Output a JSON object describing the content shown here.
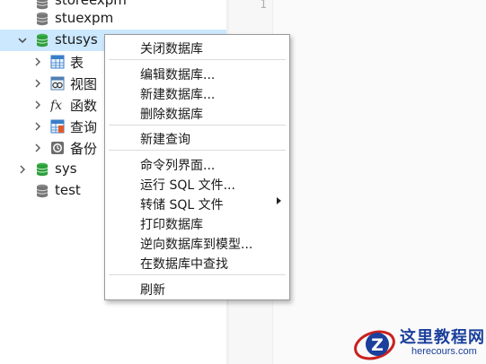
{
  "tree": {
    "items": [
      {
        "label": "storeexpm",
        "icon": "database-icon"
      },
      {
        "label": "stuexpm",
        "icon": "database-icon"
      },
      {
        "label": "stusys",
        "icon": "database-open-icon",
        "expanded": true,
        "selected": true
      },
      {
        "label": "表",
        "icon": "table-icon"
      },
      {
        "label": "视图",
        "icon": "view-icon"
      },
      {
        "label": "函数",
        "icon": "function-icon"
      },
      {
        "label": "查询",
        "icon": "query-icon"
      },
      {
        "label": "备份",
        "icon": "backup-icon"
      },
      {
        "label": "sys",
        "icon": "database-open-icon"
      },
      {
        "label": "test",
        "icon": "database-icon"
      }
    ]
  },
  "editor": {
    "line_number": "1"
  },
  "context_menu": {
    "items": [
      {
        "label": "关闭数据库"
      },
      {
        "label": "编辑数据库..."
      },
      {
        "label": "新建数据库..."
      },
      {
        "label": "删除数据库"
      },
      {
        "label": "新建查询"
      },
      {
        "label": "命令列界面..."
      },
      {
        "label": "运行 SQL 文件..."
      },
      {
        "label": "转储 SQL 文件",
        "has_submenu": true
      },
      {
        "label": "打印数据库"
      },
      {
        "label": "逆向数据库到模型..."
      },
      {
        "label": "在数据库中查找"
      },
      {
        "label": "刷新"
      }
    ]
  },
  "watermark": {
    "title": "这里教程网",
    "url": "herecours.com",
    "logo_letter": "Z"
  },
  "colors": {
    "selection": "#cce8ff",
    "db_green": "#2e9e3e",
    "db_gray": "#777777",
    "watermark_blue": "#1a3f9c",
    "watermark_red": "#c8211f"
  }
}
